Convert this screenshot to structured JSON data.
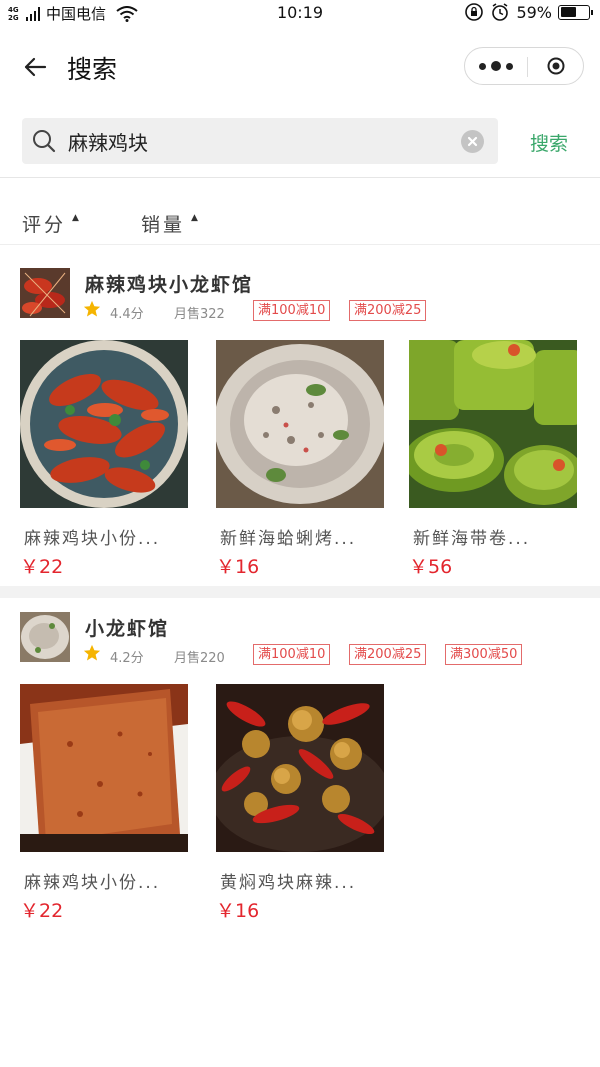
{
  "status_bar": {
    "network_tag_top": "4G",
    "network_tag_bottom": "2G",
    "carrier": "中国电信",
    "time": "10:19",
    "battery_percent": "59%",
    "battery_level": 0.59,
    "icons": [
      "signal-icon",
      "wifi-icon",
      "orientation-lock-icon",
      "alarm-icon",
      "battery-icon"
    ]
  },
  "nav": {
    "title": "搜索",
    "back_icon": "back-arrow-icon",
    "more_icon": "more-dots-icon",
    "close_icon": "target-close-icon"
  },
  "search": {
    "value": "麻辣鸡块",
    "button_label": "搜索",
    "accent_color": "#3aa76a"
  },
  "sort": {
    "rating_label": "评分",
    "sales_label": "销量"
  },
  "shops": [
    {
      "name": "麻辣鸡块小龙虾馆",
      "rating": "4.4分",
      "sales": "月售322",
      "promos": [
        "满100减10",
        "满200减25"
      ],
      "items": [
        {
          "name": "麻辣鸡块小份...",
          "price": "￥22"
        },
        {
          "name": "新鲜海蛤蜊烤...",
          "price": "￥16"
        },
        {
          "name": "新鲜海带卷...",
          "price": "￥56"
        }
      ]
    },
    {
      "name": "小龙虾馆",
      "rating": "4.2分",
      "sales": "月售220",
      "promos": [
        "满100减10",
        "满200减25",
        "满300减50"
      ],
      "items": [
        {
          "name": "麻辣鸡块小份...",
          "price": "￥22"
        },
        {
          "name": "黄焖鸡块麻辣...",
          "price": "￥16"
        }
      ]
    }
  ],
  "colors": {
    "price": "#e3262e",
    "promo_border": "#e36b6b",
    "star": "#f5b400"
  }
}
